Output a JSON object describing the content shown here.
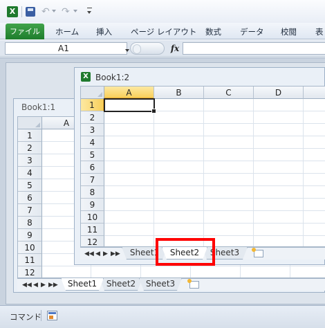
{
  "quick_access": {
    "app_icon": "excel-icon",
    "items": [
      {
        "name": "save-icon"
      },
      {
        "name": "undo-icon",
        "glyph": "↶"
      },
      {
        "name": "redo-icon",
        "glyph": "↷"
      },
      {
        "name": "customize-icon"
      }
    ]
  },
  "ribbon": {
    "file_tab": "ファイル",
    "tabs": [
      "ホーム",
      "挿入",
      "ページ レイアウト",
      "数式",
      "データ",
      "校閲",
      "表"
    ]
  },
  "formula_bar": {
    "name_box": "A1",
    "fx_label": "fx",
    "formula": ""
  },
  "window_back": {
    "title": "Book1:1",
    "columns": [
      "A"
    ],
    "rows": [
      "1",
      "2",
      "3",
      "4",
      "5",
      "6",
      "7",
      "8",
      "9",
      "10",
      "11",
      "12"
    ],
    "sheets": [
      "Sheet1",
      "Sheet2",
      "Sheet3"
    ],
    "active_sheet": "Sheet1"
  },
  "window_front": {
    "title": "Book1:2",
    "columns": [
      "A",
      "B",
      "C",
      "D"
    ],
    "rows": [
      "1",
      "2",
      "3",
      "4",
      "5",
      "6",
      "7",
      "8",
      "9",
      "10",
      "11",
      "12"
    ],
    "sheets": [
      "Sheet1",
      "Sheet2",
      "Sheet3"
    ],
    "active_sheet": "Sheet2",
    "selected_cell": "A1"
  },
  "sheet_nav": [
    "◀◀",
    "◀",
    "▶",
    "▶▶"
  ],
  "status_bar": {
    "mode": "コマンド"
  },
  "colors": {
    "file_tab": "#2b8a37",
    "selection_header": "#f8cf5b",
    "highlight_box": "#ff0000"
  }
}
